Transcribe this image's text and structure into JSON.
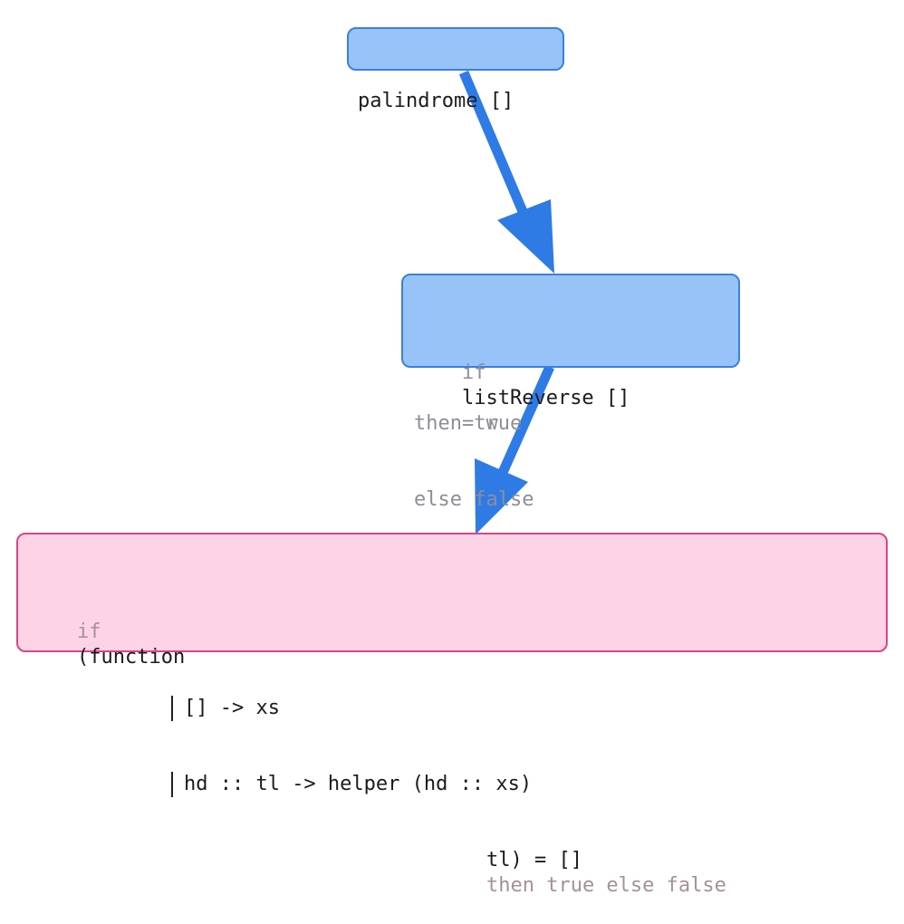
{
  "nodes": {
    "root": {
      "text": "palindrome []"
    },
    "middle": {
      "line1_keyword": "if",
      "line1_expr": "listReverse []",
      "line1_tail": "= w",
      "line2": "then true",
      "line3": "else false"
    },
    "bottom": {
      "line1_keyword": "if",
      "line1_expr": "(function",
      "case1": "[] -> xs",
      "case2": "hd :: tl -> helper (hd :: xs)",
      "line4_expr": "tl) = []",
      "line4_tail": "then true else false"
    }
  },
  "colors": {
    "blue_fill": "#98c3f9",
    "blue_border": "#3b7fe0",
    "pink_fill": "#fdd3e6",
    "pink_border": "#d9448a",
    "arrow": "#2f7be5"
  }
}
